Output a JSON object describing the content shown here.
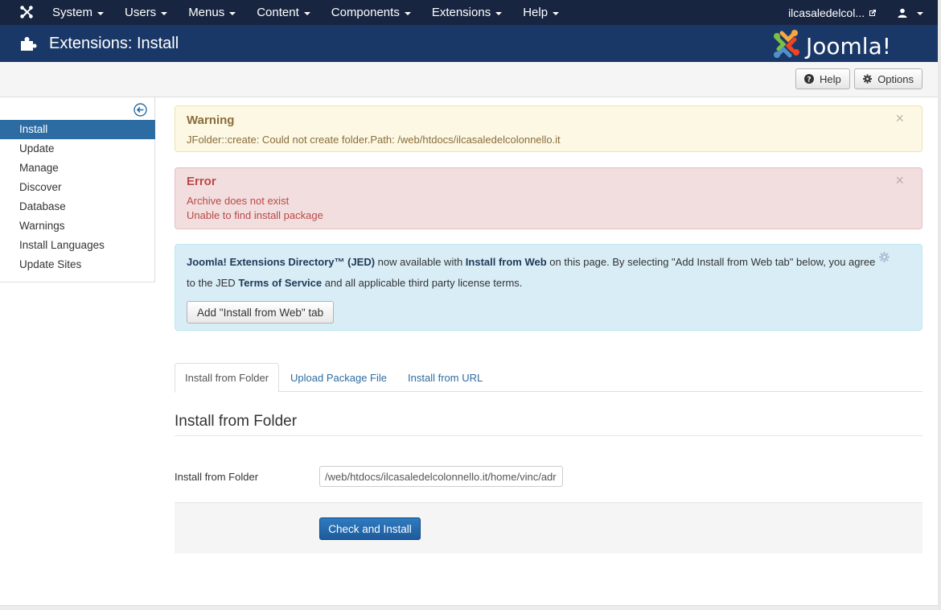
{
  "nav": {
    "items": [
      {
        "label": "System"
      },
      {
        "label": "Users"
      },
      {
        "label": "Menus"
      },
      {
        "label": "Content"
      },
      {
        "label": "Components"
      },
      {
        "label": "Extensions"
      },
      {
        "label": "Help"
      }
    ],
    "site_name": "ilcasaledelcol..."
  },
  "header": {
    "title": "Extensions: Install",
    "brand": "Joomla!"
  },
  "toolbar": {
    "help_label": "Help",
    "options_label": "Options"
  },
  "sidebar": {
    "items": [
      {
        "label": "Install",
        "active": true
      },
      {
        "label": "Update"
      },
      {
        "label": "Manage"
      },
      {
        "label": "Discover"
      },
      {
        "label": "Database"
      },
      {
        "label": "Warnings"
      },
      {
        "label": "Install Languages"
      },
      {
        "label": "Update Sites"
      }
    ]
  },
  "warning": {
    "heading": "Warning",
    "message": "JFolder::create: Could not create folder.Path: /web/htdocs/ilcasaledelcolonnello.it"
  },
  "error": {
    "heading": "Error",
    "lines": [
      "Archive does not exist",
      "Unable to find install package"
    ]
  },
  "info": {
    "jed_name": "Joomla! Extensions Directory™ (JED)",
    "text1": " now available with ",
    "install_web": "Install from Web",
    "text2": " on this page. By selecting \"Add Install from Web tab\" below, you agree",
    "text3": "to the JED ",
    "tos": "Terms of Service",
    "text4": " and all applicable third party license terms.",
    "button_label": "Add \"Install from Web\" tab"
  },
  "tabs": [
    {
      "label": "Install from Folder",
      "active": true
    },
    {
      "label": "Upload Package File"
    },
    {
      "label": "Install from URL"
    }
  ],
  "form": {
    "section_title": "Install from Folder",
    "field_label": "Install from Folder",
    "field_value": "/web/htdocs/ilcasaledelcolonnello.it/home/vinc/adr",
    "submit_label": "Check and Install"
  },
  "colors": {
    "navbar": "#172541",
    "header": "#1a3867",
    "active": "#2d6ca2",
    "primary_button": "#1d5b9c"
  }
}
